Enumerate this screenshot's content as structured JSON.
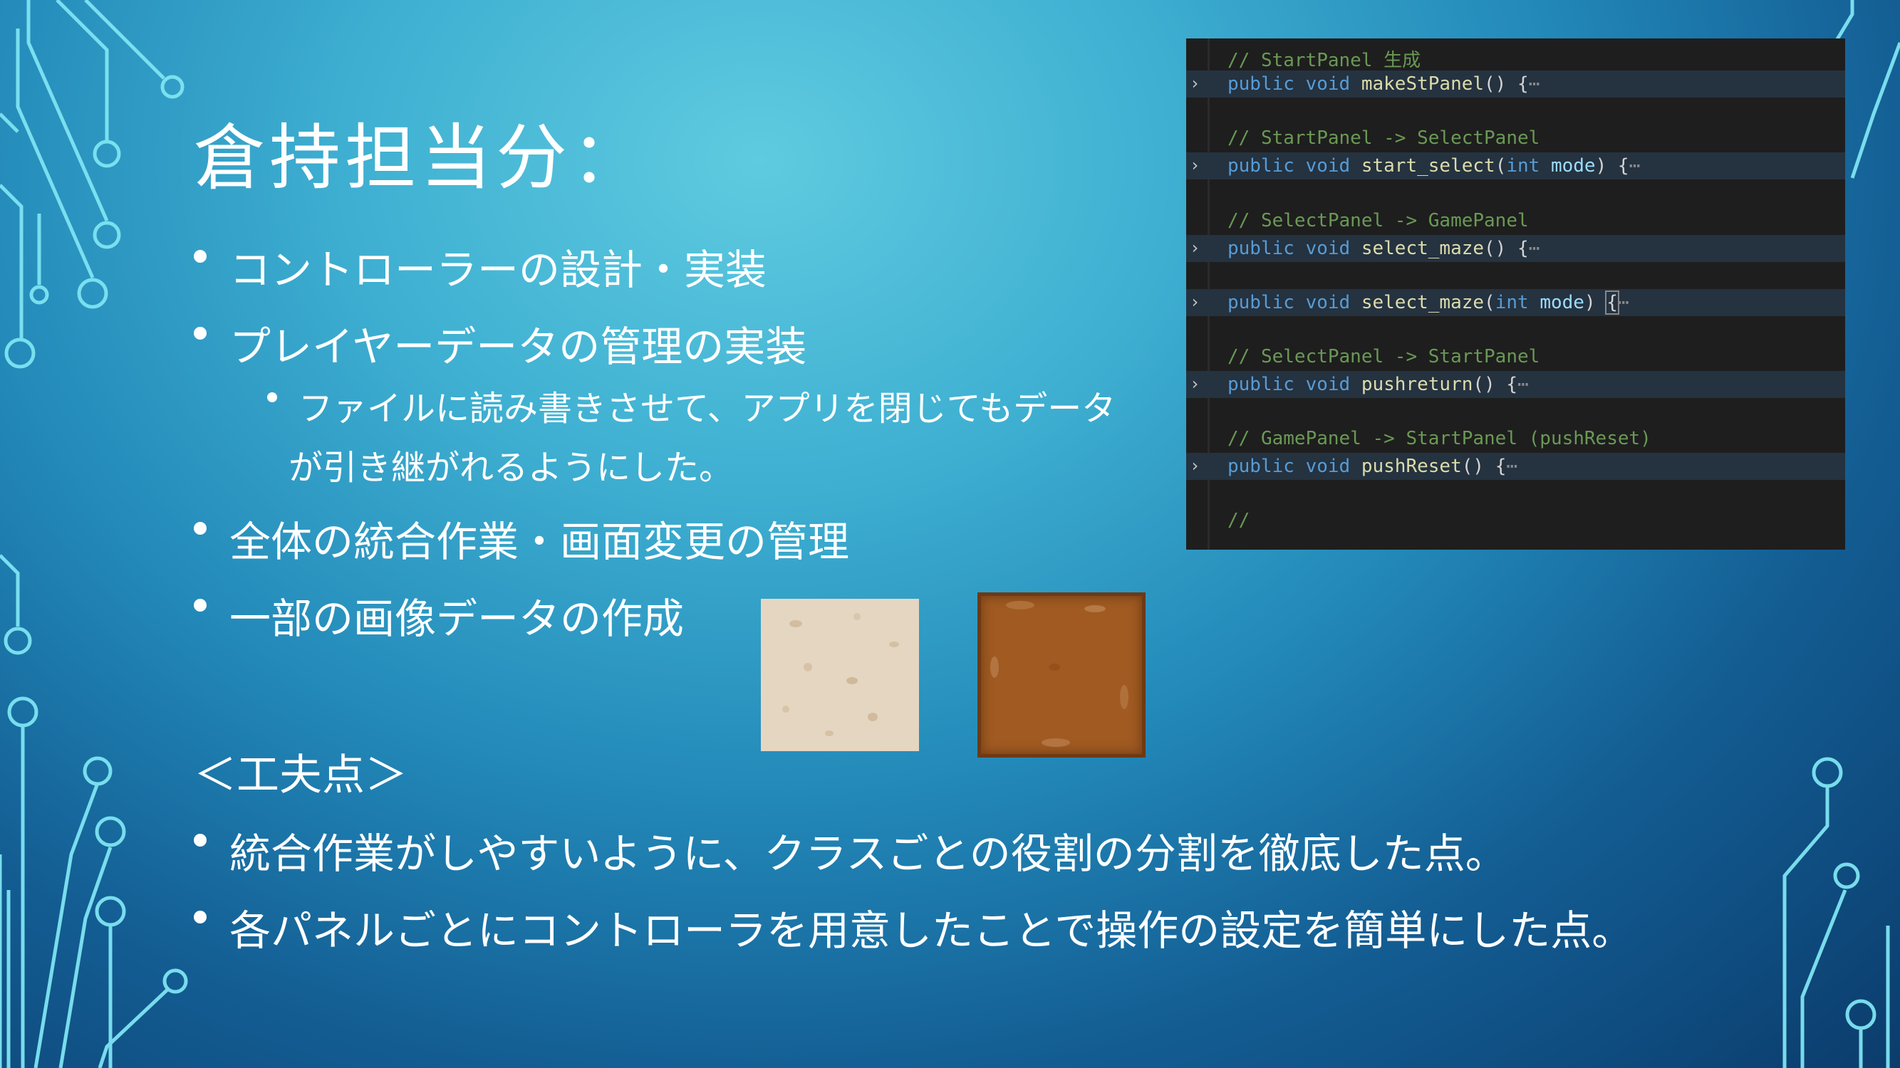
{
  "slide": {
    "title": "倉持担当分：",
    "bullets": [
      "コントローラーの設計・実装",
      "プレイヤーデータの管理の実装",
      "全体の統合作業・画面変更の管理",
      "一部の画像データの作成"
    ],
    "sub_bullet_line1": "ファイルに読み書きさせて、アプリを閉じてもデータ",
    "sub_bullet_line2": "が引き継がれるようにした。",
    "section_label": "＜工夫点＞",
    "points": [
      "統合作業がしやすいように、クラスごとの役割の分割を徹底した点。",
      "各パネルごとにコントローラを用意したことで操作の設定を簡単にした点。"
    ]
  },
  "code": {
    "comment1": "// StartPanel 生成",
    "m1_kw": "public void",
    "m1_name": "makeStPanel",
    "m1_tail": "() {",
    "comment2": "// StartPanel -> SelectPanel",
    "m2_kw": "public void",
    "m2_name": "start_select",
    "m2_open": "(",
    "m2_type": "int",
    "m2_param": "mode",
    "m2_tail": ") {",
    "comment3": "// SelectPanel -> GamePanel",
    "m3_kw": "public void",
    "m3_name": "select_maze",
    "m3_tail": "() {",
    "m4_kw": "public void",
    "m4_name": "select_maze",
    "m4_open": "(",
    "m4_type": "int",
    "m4_param": "mode",
    "m4_close": ") ",
    "m4_brace": "{",
    "comment5": "// SelectPanel -> StartPanel",
    "m5_kw": "public void",
    "m5_name": "pushreturn",
    "m5_tail": "() {",
    "comment6": "// GamePanel -> StartPanel (pushReset)",
    "m6_kw": "public void",
    "m6_name": "pushReset",
    "m6_tail": "() {",
    "comment7": "//",
    "ellipsis": "⋯",
    "fold_icon": "chevron-right"
  },
  "colors": {
    "background_center": "#5fcbe0",
    "background_edge": "#0b3c6c",
    "circuit_line": "#6fe0f0",
    "code_bg": "#1e1e1e",
    "code_comment": "#6a9955",
    "code_keyword": "#569cd6",
    "code_function": "#dcdcaa",
    "code_param": "#9cdcfe",
    "tile_sand": "#e5d6c2",
    "tile_dirt": "#a05a22"
  }
}
